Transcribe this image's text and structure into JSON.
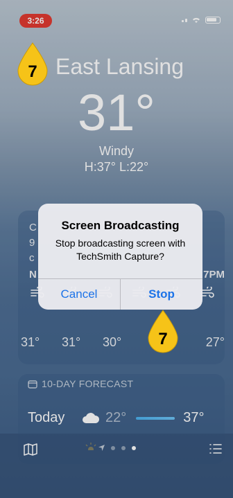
{
  "status_bar": {
    "time": "3:26"
  },
  "weather": {
    "city": "East Lansing",
    "temperature": "31°",
    "condition": "Windy",
    "high_low": "H:37° L:22°"
  },
  "hourly_card": {
    "obscured_text": [
      "C",
      "9",
      "c"
    ],
    "first_hour_label": "N",
    "last_hour_label": "7PM",
    "temps": [
      "31°",
      "31°",
      "30°",
      "27°"
    ]
  },
  "forecast": {
    "title": "10-DAY FORECAST",
    "rows": [
      {
        "day": "Today",
        "low": "22°",
        "high": "37°"
      }
    ]
  },
  "bottom_bar": {
    "dots": 3,
    "active_dot": 2
  },
  "alert": {
    "title": "Screen Broadcasting",
    "message": "Stop broadcasting screen with TechSmith Capture?",
    "cancel": "Cancel",
    "stop": "Stop"
  },
  "callouts": {
    "top": "7",
    "stop": "7"
  },
  "colors": {
    "status_pill": "#e23b32",
    "alert_button_text": "#1c73e8",
    "callout_yellow": "#f6c318"
  }
}
